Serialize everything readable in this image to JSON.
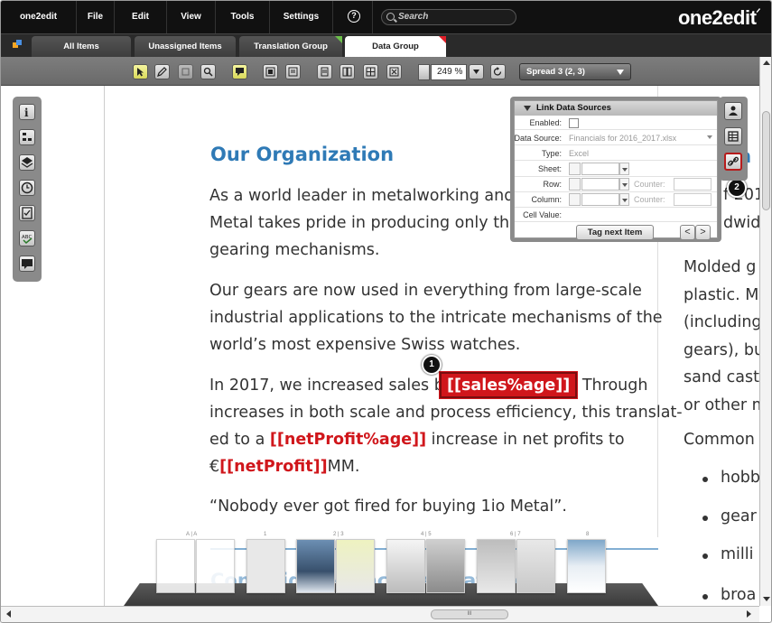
{
  "menubar": {
    "app": "one2edit",
    "items": [
      "File",
      "Edit",
      "View",
      "Tools",
      "Settings"
    ],
    "help": "?",
    "search_placeholder": "Search",
    "logo": "one2edit"
  },
  "tabs": [
    {
      "label": "All Items"
    },
    {
      "label": "Unassigned Items"
    },
    {
      "label": "Translation Group",
      "flag_color": "#6cc04a"
    },
    {
      "label": "Data Group",
      "flag_color": "#e0202a",
      "active": true
    }
  ],
  "toolbar": {
    "zoom": "249 %",
    "spread": "Spread 3 (2, 3)"
  },
  "document": {
    "heading": "Our Organization",
    "p1": [
      "As a world leader in metalworking and m",
      "Metal takes pride in producing only the A",
      "gearing mechanisms."
    ],
    "p2": [
      "Our gears are now used in everything from large-scale",
      "industrial applications to the intricate mechanisms of the",
      "world’s most expensive Swiss watches."
    ],
    "p3_line1_pre": "In 2017, we increased sales by ",
    "p3_tag_sales": "[[sales%age]]",
    "p3_line1_post": ". Through",
    "p3_line2": "increases in both scale and process efficiency, this translat-",
    "p3_line3_pre": "ed to a ",
    "p3_tag_netprofit_pct": "[[netProfit%age]]",
    "p3_line3_post": " increase in net profits to",
    "p3_line4_pre": "€",
    "p3_tag_netprofit": "[[netProfit]]",
    "p3_line4_post": "MM.",
    "quote": "“Nobody ever got fired for buying 1io Metal”.",
    "heading2": "Consolidated Income Statement",
    "right_col": {
      "fragments": [
        "a",
        "f 201",
        "dwide"
      ],
      "lines": [
        "Molded g",
        "plastic. M",
        "(including",
        "gears), bu",
        "sand cast",
        "or other m"
      ],
      "common": "Common",
      "bullets": [
        "hobb",
        "gear",
        "milli",
        "broa"
      ]
    }
  },
  "markers": {
    "m1": "1",
    "m2": "2"
  },
  "link_panel": {
    "title": "Link Data Sources",
    "enabled_label": "Enabled:",
    "datasource_label": "Data Source:",
    "datasource_value": "Financials for 2016_2017.xlsx",
    "type_label": "Type:",
    "type_value": "Excel",
    "sheet_label": "Sheet:",
    "row_label": "Row:",
    "column_label": "Column:",
    "counter_label": "Counter:",
    "cellvalue_label": "Cell Value:",
    "tag_button": "Tag next Item",
    "prev": "<",
    "next": ">"
  },
  "thumbnails": {
    "labels": [
      "A | A",
      "1",
      "2 | 3",
      "4 | 5",
      "6 | 7",
      "8"
    ]
  },
  "scrollbar": {
    "grip": "III"
  }
}
